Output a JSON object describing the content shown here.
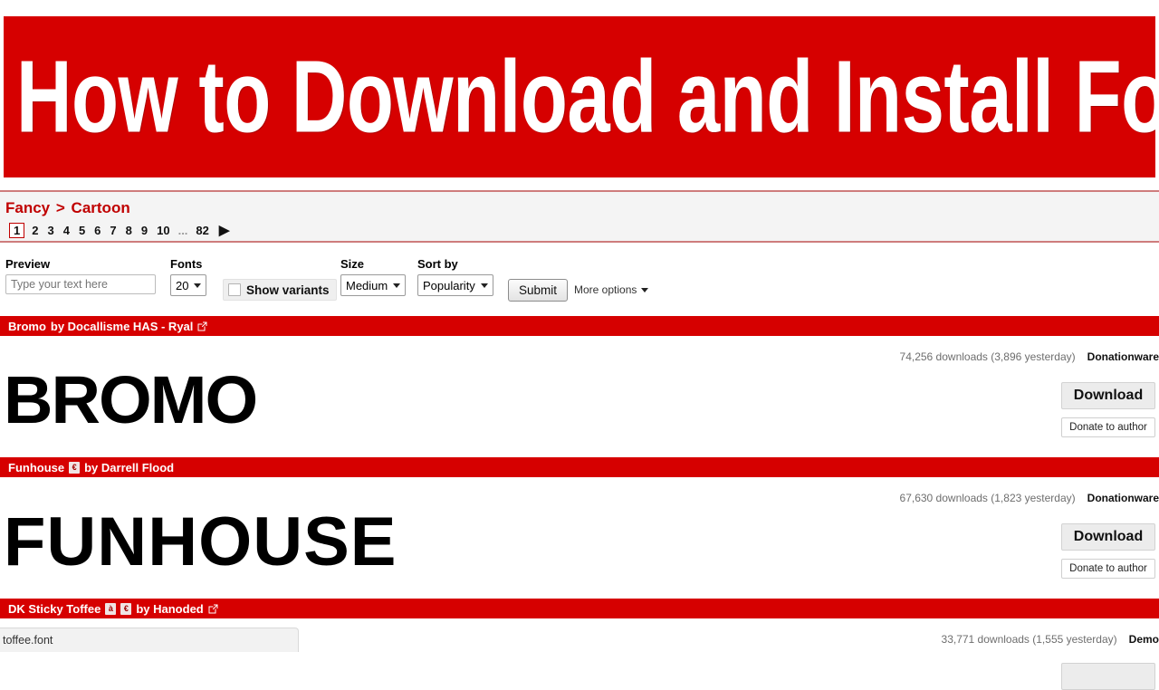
{
  "banner": {
    "title": "How to Download and Install Fonts",
    "bg_color": "#D60000",
    "text_color": "#FFFFFF"
  },
  "breadcrumb": {
    "parent": "Fancy",
    "separator": ">",
    "current": "Cartoon"
  },
  "pagination": {
    "pages": [
      "1",
      "2",
      "3",
      "4",
      "5",
      "6",
      "7",
      "8",
      "9",
      "10"
    ],
    "ellipsis": "...",
    "last_page": "82",
    "current_page": "1",
    "next_arrow": "▶"
  },
  "toolbar": {
    "preview_label": "Preview",
    "preview_placeholder": "Type your text here",
    "preview_value": "",
    "fonts_label": "Fonts",
    "fonts_value": "20",
    "show_variants_label": "Show variants",
    "show_variants_checked": false,
    "size_label": "Size",
    "size_value": "Medium",
    "sort_label": "Sort by",
    "sort_value": "Popularity",
    "submit_label": "Submit",
    "more_options_label": "More options"
  },
  "fonts": [
    {
      "name": "Bromo",
      "byline": "by Docallisme HAS - Ryal",
      "badges": [],
      "external_link": true,
      "downloads": "74,256 downloads (3,896 yesterday)",
      "license": "Donationware",
      "preview": "BROMO",
      "download_label": "Download",
      "donate_label": "Donate to author"
    },
    {
      "name": "Funhouse",
      "byline": "by Darrell Flood",
      "badges": [
        "€"
      ],
      "external_link": false,
      "downloads": "67,630 downloads (1,823 yesterday)",
      "license": "Donationware",
      "preview": "FUNHOUSE",
      "download_label": "Download",
      "donate_label": "Donate to author"
    },
    {
      "name": "DK Sticky Toffee",
      "byline": "by Hanoded",
      "badges": [
        "à",
        "€"
      ],
      "external_link": true,
      "downloads": "33,771 downloads (1,555 yesterday)",
      "license": "Demo",
      "preview": "",
      "download_label": "",
      "donate_label": ""
    }
  ],
  "download_bar": {
    "filename": "toffee.font"
  }
}
